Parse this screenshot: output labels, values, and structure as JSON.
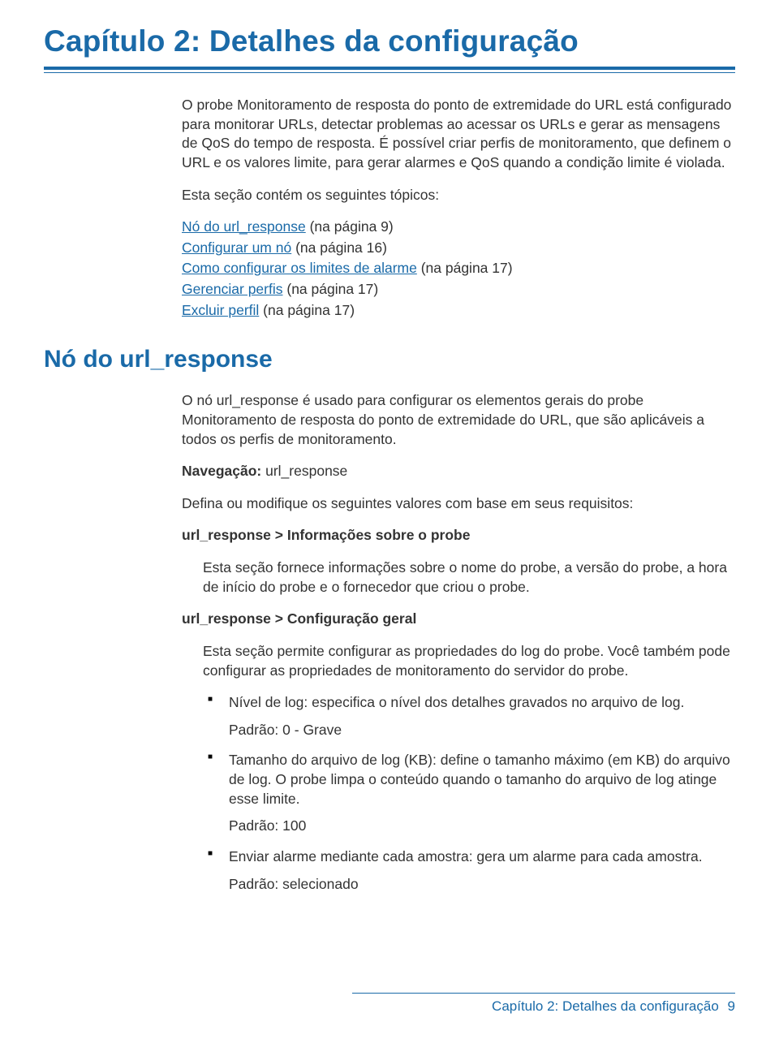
{
  "chapter": {
    "title": "Capítulo 2: Detalhes da configuração",
    "intro": "O probe Monitoramento de resposta do ponto de extremidade do URL está configurado para monitorar URLs, detectar problemas ao acessar os URLs e gerar as mensagens de QoS do tempo de resposta. É possível criar perfis de monitoramento, que definem o URL e os valores limite, para gerar alarmes e QoS quando a condição limite é violada.",
    "toc_lead": "Esta seção contém os seguintes tópicos:",
    "toc": [
      {
        "link": "Nó do url_response",
        "suffix": " (na página 9)"
      },
      {
        "link": "Configurar um nó",
        "suffix": " (na página 16)"
      },
      {
        "link": "Como configurar os limites de alarme",
        "suffix": " (na página 17)"
      },
      {
        "link": "Gerenciar perfis",
        "suffix": " (na página 17)"
      },
      {
        "link": "Excluir perfil",
        "suffix": " (na página 17)"
      }
    ]
  },
  "section": {
    "title": "Nó do url_response",
    "para1": "O nó url_response é usado para configurar os elementos gerais do probe Monitoramento de resposta do ponto de extremidade do URL, que são aplicáveis a todos os perfis de monitoramento.",
    "nav_label": "Navegação:",
    "nav_value": " url_response",
    "para2": "Defina ou modifique os seguintes valores com base em seus requisitos:",
    "sub1_title": "url_response > Informações sobre o probe",
    "sub1_body": "Esta seção fornece informações sobre o nome do probe, a versão do probe, a hora de início do probe e o fornecedor que criou o probe.",
    "sub2_title": "url_response > Configuração geral",
    "sub2_body": "Esta seção permite configurar as propriedades do log do probe. Você também pode configurar as propriedades de monitoramento do servidor do probe.",
    "bullets": [
      {
        "text": "Nível de log: especifica o nível dos detalhes gravados no arquivo de log.",
        "padrao": "Padrão: 0 - Grave"
      },
      {
        "text": "Tamanho do arquivo de log (KB): define o tamanho máximo (em KB) do arquivo de log. O probe limpa o conteúdo quando o tamanho do arquivo de log atinge esse limite.",
        "padrao": "Padrão: 100"
      },
      {
        "text": "Enviar alarme mediante cada amostra: gera um alarme para cada amostra.",
        "padrao": "Padrão: selecionado"
      }
    ]
  },
  "footer": {
    "text": "Capítulo 2: Detalhes da configuração",
    "page": "9"
  }
}
